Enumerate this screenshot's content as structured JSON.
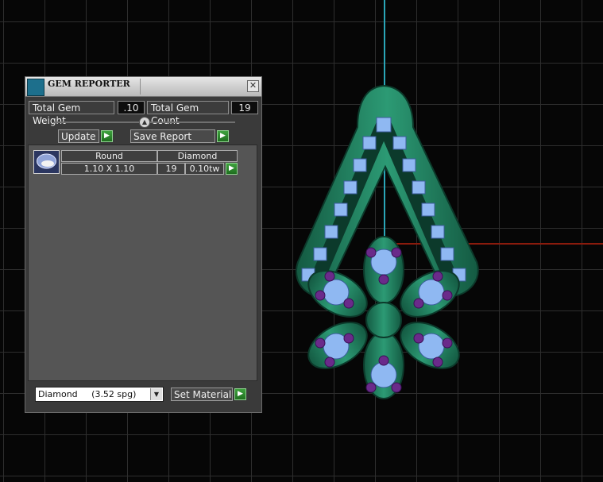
{
  "panel": {
    "title": "GEM REPORTER",
    "close_glyph": "✕",
    "total_weight_label": "Total Gem Weight",
    "total_weight_value": ".10",
    "total_count_label": "Total Gem Count",
    "total_count_value": "19",
    "update_label": "Update",
    "save_report_label": "Save Report",
    "table": {
      "cut": "Round",
      "material": "Diamond",
      "size": "1.10 X 1.10",
      "count": "19",
      "weight": "0.10tw"
    },
    "material_select": "Diamond     (3.52 spg)",
    "set_material_label": "Set Material"
  },
  "icons": {
    "panel_icon": "gem-reporter-icon",
    "close": "close-icon",
    "slider_knob": "slider-knob-icon",
    "go": "play-arrow-icon",
    "dropdown": "chevron-down-icon",
    "gem_thumbnail": "round-gem-icon"
  },
  "colors": {
    "metal": "#1f7a5c",
    "gem": "#8fb8f2",
    "prong": "#6a2a8a",
    "axis_vertical": "#2aa6b8",
    "axis_horizontal": "#8a1b0c"
  }
}
